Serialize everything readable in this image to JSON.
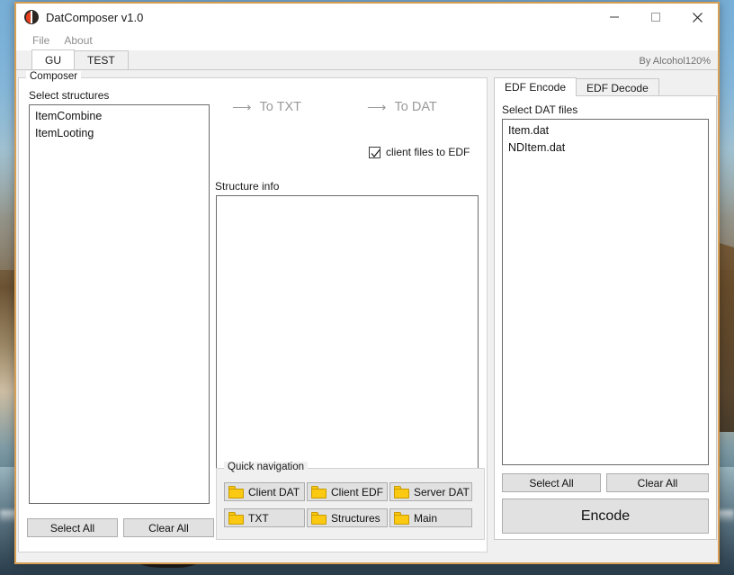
{
  "window": {
    "title": "DatComposer v1.0",
    "icon": "app-circle-icon",
    "border_color": "#d9a055",
    "controls": {
      "minimize": "minimize-icon",
      "maximize": "maximize-icon",
      "close": "close-icon"
    }
  },
  "menubar": {
    "items": [
      {
        "label": "File"
      },
      {
        "label": "About"
      }
    ]
  },
  "tabs": {
    "items": [
      {
        "label": "GU",
        "active": true
      },
      {
        "label": "TEST",
        "active": false
      }
    ],
    "brand_note": "By Alcohol120%"
  },
  "composer": {
    "group_label": "Composer",
    "select_structures_label": "Select structures",
    "structures": [
      "ItemCombine",
      "ItemLooting"
    ],
    "select_all_label": "Select All",
    "clear_all_label": "Clear All",
    "actions": [
      {
        "arrow": "arrow-right-icon",
        "label": "To TXT",
        "enabled": false
      },
      {
        "arrow": "arrow-right-icon",
        "label": "To DAT",
        "enabled": false
      }
    ],
    "checkbox": {
      "label": "client files to EDF",
      "checked": true
    },
    "structure_info_label": "Structure info",
    "structure_info_value": ""
  },
  "quick_navigation": {
    "group_label": "Quick navigation",
    "buttons": [
      {
        "icon": "folder-icon",
        "label": "Client DAT"
      },
      {
        "icon": "folder-icon",
        "label": "Client EDF"
      },
      {
        "icon": "folder-icon",
        "label": "Server DAT"
      },
      {
        "icon": "folder-icon",
        "label": "TXT"
      },
      {
        "icon": "folder-icon",
        "label": "Structures"
      },
      {
        "icon": "folder-icon",
        "label": "Main"
      }
    ]
  },
  "edf_panel": {
    "tabs": [
      {
        "label": "EDF Encode",
        "active": true
      },
      {
        "label": "EDF Decode",
        "active": false
      }
    ],
    "select_dat_files_label": "Select DAT files",
    "dat_files": [
      "Item.dat",
      "NDItem.dat"
    ],
    "select_all_label": "Select All",
    "clear_all_label": "Clear All",
    "encode_label": "Encode"
  },
  "colors": {
    "window_border": "#d9a055",
    "panel_bg": "#f0f0f0",
    "button_bg": "#e1e1e1",
    "folder_yellow": "#fbc911",
    "disabled_text": "#9a9a9a",
    "accent_icon_red": "#e8401f"
  }
}
